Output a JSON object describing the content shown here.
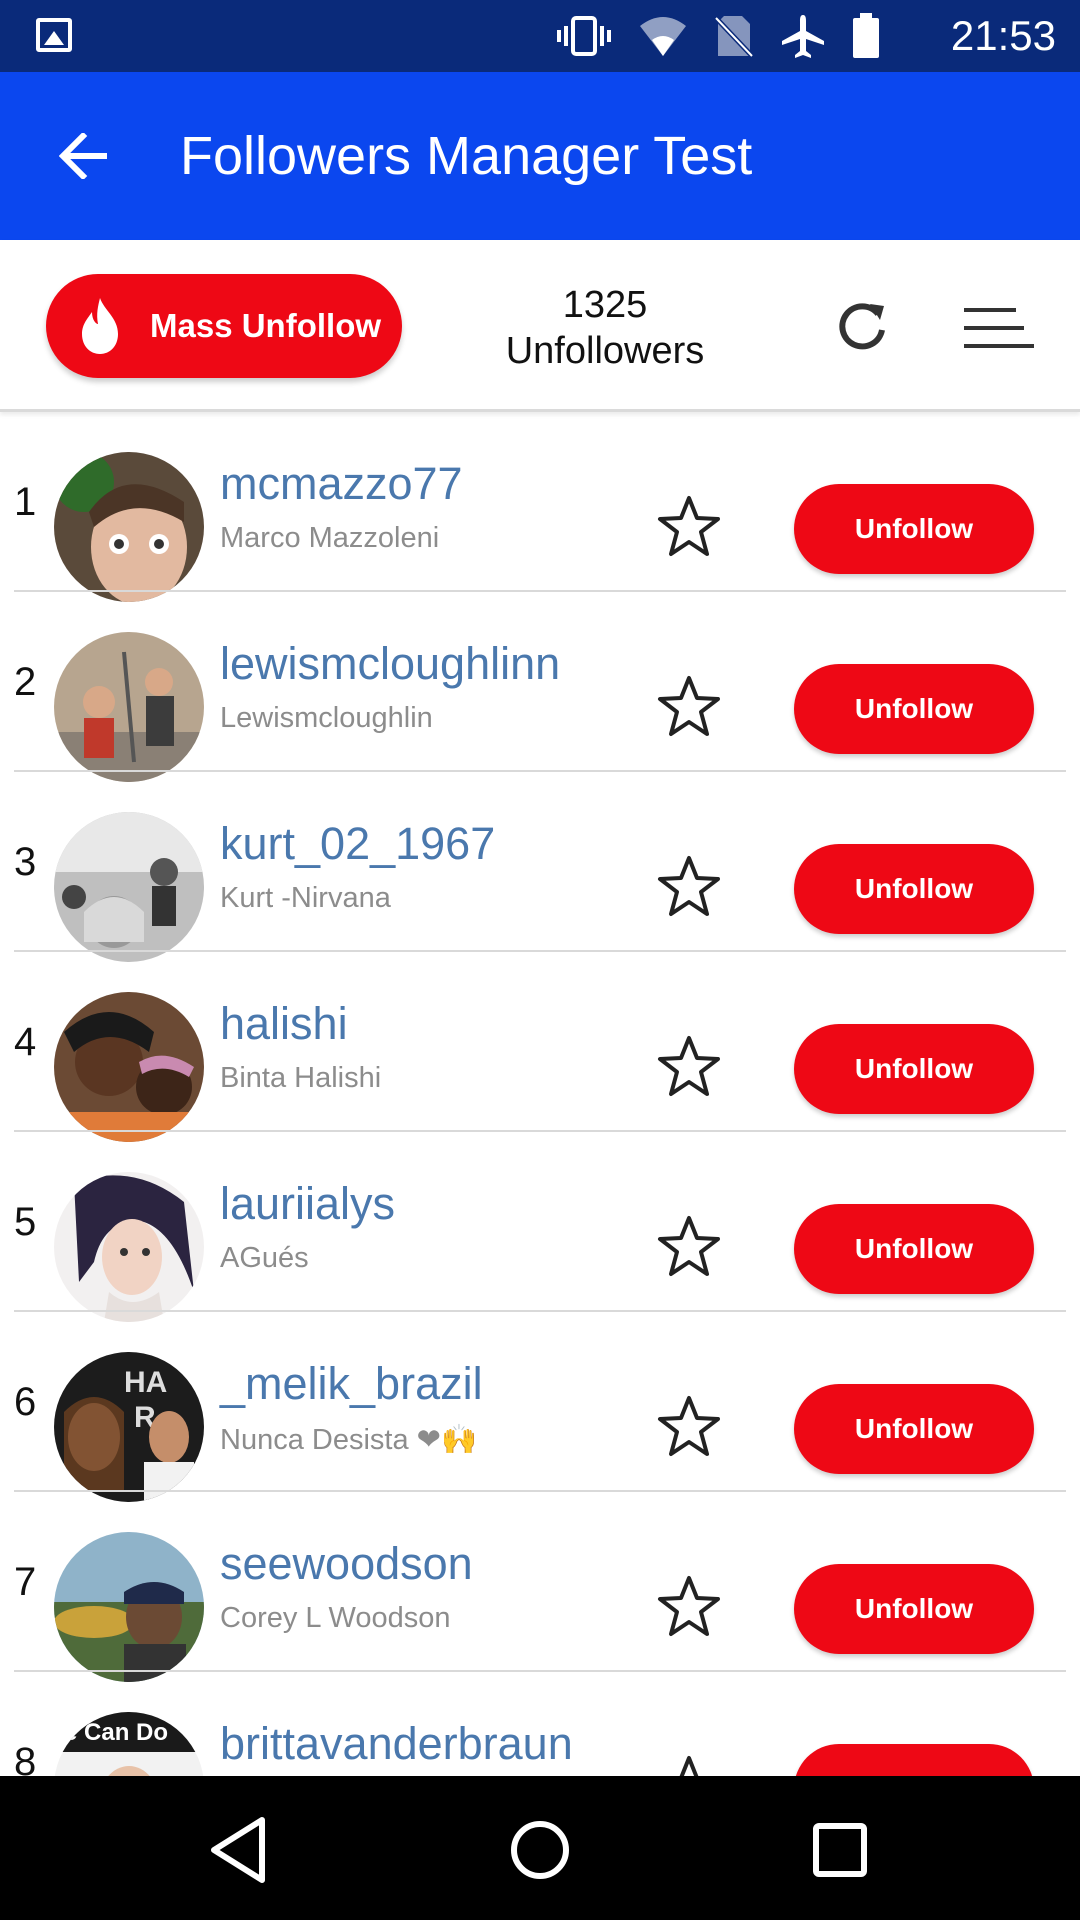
{
  "status_bar": {
    "time": "21:53",
    "icons": [
      "image-icon",
      "vibrate-icon",
      "wifi-icon",
      "no-sim-icon",
      "airplane-mode-icon",
      "battery-icon"
    ]
  },
  "app_bar": {
    "title": "Followers Manager Test",
    "back_icon": "arrow-back-icon"
  },
  "toolbar": {
    "mass_unfollow_label": "Mass Unfollow",
    "count": "1325",
    "count_label": "Unfollowers",
    "icons": [
      "flame-icon",
      "refresh-icon",
      "menu-icon"
    ]
  },
  "unfollow_label": "Unfollow",
  "rows": [
    {
      "rank": "1",
      "username": "mcmazzo77",
      "fullname": "Marco Mazzoleni"
    },
    {
      "rank": "2",
      "username": "lewismcloughlinn",
      "fullname": "Lewismcloughlin"
    },
    {
      "rank": "3",
      "username": "kurt_02_1967",
      "fullname": "Kurt -Nirvana"
    },
    {
      "rank": "4",
      "username": "halishi",
      "fullname": "Binta Halishi"
    },
    {
      "rank": "5",
      "username": "lauriialys",
      "fullname": "AGués"
    },
    {
      "rank": "6",
      "username": "_melik_brazil",
      "fullname": "Nunca Desista ❤🙌"
    },
    {
      "rank": "7",
      "username": "seewoodson",
      "fullname": "Corey L Woodson"
    },
    {
      "rank": "8",
      "username": "brittavanderbraun",
      "fullname": ""
    }
  ],
  "colors": {
    "status_bar": "#0a2a7a",
    "app_bar": "#0b47ef",
    "accent_red": "#ee0815",
    "username_blue": "#4a78ad"
  },
  "nav_bar": {
    "icons": [
      "back-triangle-icon",
      "home-circle-icon",
      "recents-square-icon"
    ]
  }
}
